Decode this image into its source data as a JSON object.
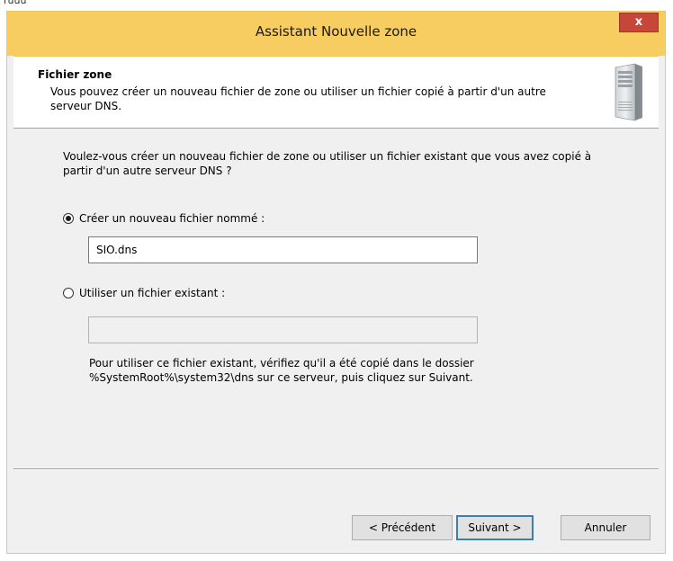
{
  "background": {
    "fragment_text": "ruuu"
  },
  "window": {
    "title": "Assistant Nouvelle zone",
    "close_label": "x",
    "accent_color": "#f7cc61",
    "close_color": "#c7463a"
  },
  "header": {
    "title": "Fichier zone",
    "subtitle": "Vous pouvez créer un nouveau fichier de zone ou utiliser un fichier copié à partir d'un autre serveur DNS.",
    "icon": "server-icon"
  },
  "body": {
    "question": "Voulez-vous créer un nouveau fichier de zone ou utiliser un fichier existant que vous avez copié à partir d'un autre serveur DNS ?",
    "option_new": {
      "label": "Créer un nouveau fichier nommé :",
      "checked": true,
      "value": "SIO.dns"
    },
    "option_existing": {
      "label": "Utiliser un fichier existant :",
      "checked": false,
      "value": ""
    },
    "note": "Pour utiliser ce fichier existant, vérifiez qu'il a été copié dans le dossier %SystemRoot%\\system32\\dns sur ce serveur, puis cliquez sur Suivant."
  },
  "buttons": {
    "back": "< Précédent",
    "next": "Suivant >",
    "cancel": "Annuler"
  }
}
